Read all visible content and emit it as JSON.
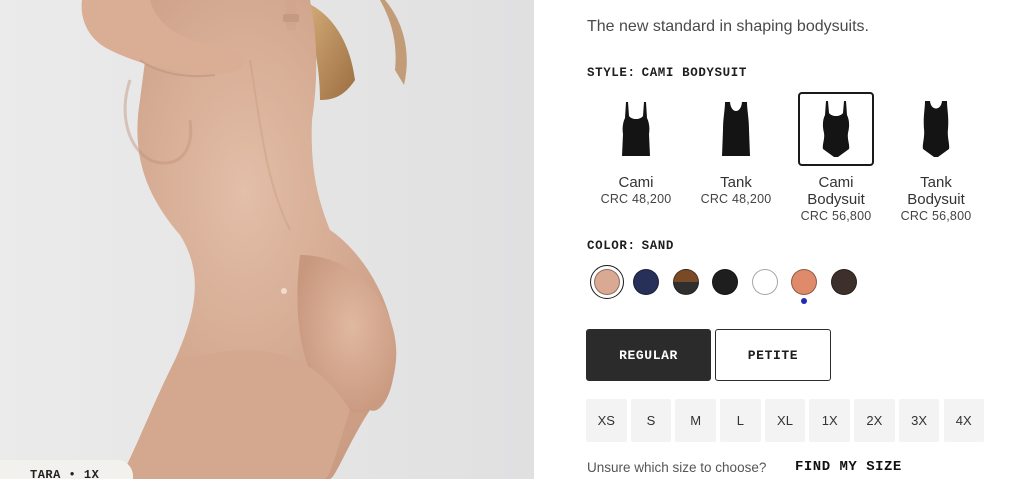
{
  "product": {
    "tagline": "The new standard in shaping bodysuits.",
    "model_tag": "TARA • 1X"
  },
  "style": {
    "label": "STYLE:",
    "selected": "CAMI BODYSUIT",
    "options": [
      {
        "name_lines": [
          "Cami"
        ],
        "price": "CRC 48,200",
        "icon": "cami-top-icon",
        "selected": false
      },
      {
        "name_lines": [
          "Tank"
        ],
        "price": "CRC 48,200",
        "icon": "tank-top-icon",
        "selected": false
      },
      {
        "name_lines": [
          "Cami",
          "Bodysuit"
        ],
        "price": "CRC 56,800",
        "icon": "cami-bodysuit-icon",
        "selected": true
      },
      {
        "name_lines": [
          "Tank",
          "Bodysuit"
        ],
        "price": "CRC 56,800",
        "icon": "tank-bodysuit-icon",
        "selected": false
      }
    ]
  },
  "color": {
    "label": "COLOR:",
    "selected": "SAND",
    "swatches": [
      {
        "name": "sand",
        "fill": "#d9a994",
        "selected": true,
        "new": false
      },
      {
        "name": "navy",
        "fill": "#273058",
        "selected": false,
        "new": false
      },
      {
        "name": "brown-black",
        "fill": "#7a4a26",
        "fill2": "#2f2f2f",
        "selected": false,
        "new": false
      },
      {
        "name": "black",
        "fill": "#1e1e1e",
        "selected": false,
        "new": false
      },
      {
        "name": "white",
        "fill": "#ffffff",
        "selected": false,
        "new": false
      },
      {
        "name": "terracotta",
        "fill": "#df8a6a",
        "selected": false,
        "new": true
      },
      {
        "name": "dark-brown",
        "fill": "#3d302b",
        "selected": false,
        "new": false
      }
    ]
  },
  "fit": {
    "regular": "REGULAR",
    "petite": "PETITE",
    "selected": "REGULAR"
  },
  "sizes": [
    "XS",
    "S",
    "M",
    "L",
    "XL",
    "1X",
    "2X",
    "3X",
    "4X"
  ],
  "size_help": {
    "text": "Unsure which size to choose?",
    "link": "FIND MY SIZE"
  },
  "colors": {
    "skin": "#dcb49e",
    "background": "#e6e6e7",
    "accent_dark": "#2b2b2b"
  }
}
